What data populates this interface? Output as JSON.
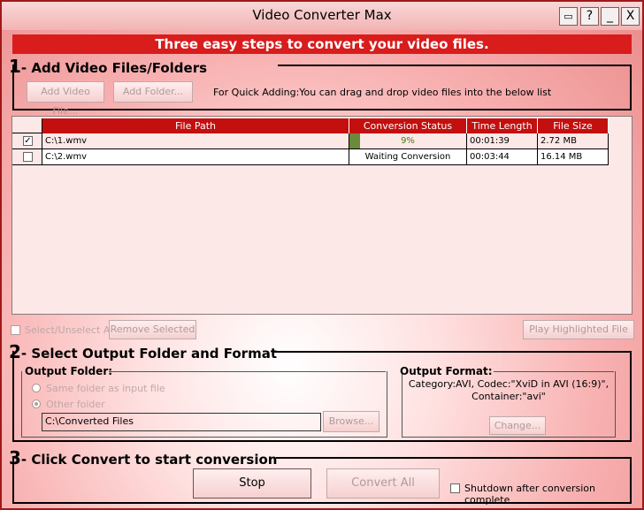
{
  "window": {
    "title": "Video Converter Max",
    "buttons": [
      "▭",
      "?",
      "_",
      "X"
    ]
  },
  "banner": "Three easy steps to convert your video files.",
  "step1": {
    "num": "1",
    "title": "- Add Video Files/Folders",
    "add_file": "Add Video File...",
    "add_folder": "Add Folder...",
    "hint": "For Quick Adding:You can drag and drop video files into the below list"
  },
  "list": {
    "columns": [
      "File Path",
      "Conversion Status",
      "Time Length",
      "File Size"
    ],
    "rows": [
      {
        "checked": true,
        "path": "C:\\1.wmv",
        "status": "9%",
        "progress": 0.09,
        "time": "00:01:39",
        "size": "2.72 MB"
      },
      {
        "checked": false,
        "path": "C:\\2.wmv",
        "status": "Waiting Conversion",
        "progress": 0,
        "time": "00:03:44",
        "size": "16.14 MB"
      }
    ]
  },
  "list_controls": {
    "select_all": "Select/Unselect All",
    "remove": "Remove Selected",
    "play": "Play Highlighted File"
  },
  "step2": {
    "num": "2",
    "title": "- Select Output Folder and Format",
    "output_folder_label": "Output Folder:",
    "same_folder": "Same folder as input file",
    "other_folder": "Other folder",
    "folder_value": "C:\\Converted Files",
    "browse": "Browse...",
    "output_format_label": "Output Format:",
    "format_line1": "Category:AVI, Codec:\"XviD in AVI (16:9)\",",
    "format_line2": "Container:\"avi\"",
    "change": "Change..."
  },
  "step3": {
    "num": "3",
    "title": "- Click Convert to start conversion",
    "stop": "Stop",
    "convert_all": "Convert All",
    "shutdown": "Shutdown after conversion complete"
  }
}
